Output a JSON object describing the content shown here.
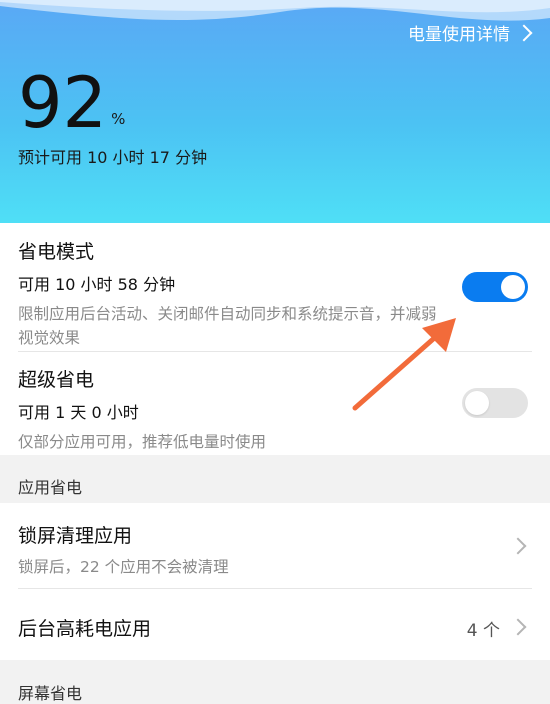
{
  "header": {
    "detail_link": "电量使用详情",
    "battery_percent": "92",
    "percent_unit": "%",
    "estimate": "预计可用 10 小时 17 分钟"
  },
  "power_saving": {
    "title": "省电模式",
    "available": "可用 10 小时 58 分钟",
    "description": "限制应用后台活动、关闭邮件自动同步和系统提示音，并减弱视觉效果",
    "enabled": true
  },
  "super_saving": {
    "title": "超级省电",
    "available": "可用 1 天 0 小时",
    "description": "仅部分应用可用，推荐低电量时使用",
    "enabled": false
  },
  "app_section": {
    "label": "应用省电",
    "lock_cleanup": {
      "title": "锁屏清理应用",
      "description": "锁屏后，22 个应用不会被清理"
    },
    "high_drain": {
      "title": "后台高耗电应用",
      "count": "4 个"
    }
  },
  "screen_section": {
    "label": "屏幕省电"
  },
  "colors": {
    "toggle_on": "#0a7cf0",
    "toggle_off": "#e3e3e3",
    "annotation_arrow": "#f26b3a"
  }
}
